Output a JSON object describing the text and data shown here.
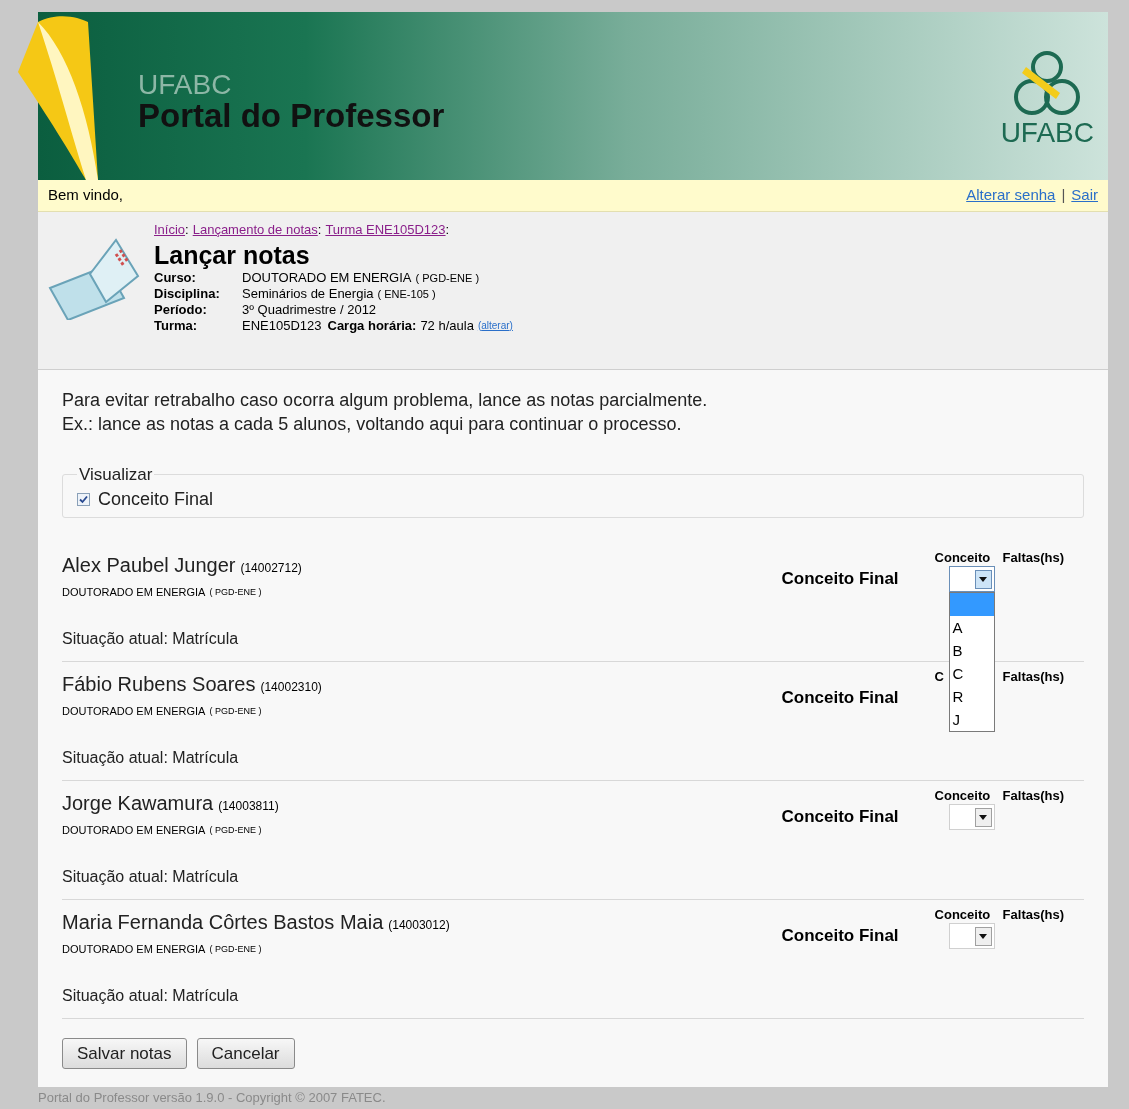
{
  "header": {
    "brand_small": "UFABC",
    "title": "Portal do Professor",
    "logo_text": "UFABC"
  },
  "welcome_bar": {
    "greeting": "Bem vindo,",
    "links": [
      "Alterar senha",
      "Sair"
    ],
    "separator": "|"
  },
  "breadcrumb": [
    "Início",
    "Lançamento de notas",
    "Turma ENE105D123"
  ],
  "breadcrumb_separator": ":",
  "page_title": "Lançar notas",
  "course_info": [
    {
      "label": "Curso:",
      "value": "DOUTORADO EM ENERGIA",
      "code": "( PGD-ENE )"
    },
    {
      "label": "Disciplina:",
      "value": "Seminários de Energia",
      "code": "( ENE-105 )"
    },
    {
      "label": "Período:",
      "value": "3º Quadrimestre / 2012"
    },
    {
      "label": "Turma:",
      "value": "ENE105D123",
      "extra_label": "Carga horária:",
      "extra_value": "72 h/aula",
      "link": "alterar",
      "link_open": "(",
      "link_close": ")"
    }
  ],
  "instructions": [
    "Para evitar retrabalho caso ocorra algum problema, lance as notas parcialmente.",
    "Ex.: lance as notas a cada 5 alunos, voltando aqui para continuar o processo."
  ],
  "view_options": {
    "legend": "Visualizar",
    "options": [
      {
        "label": "Conceito Final",
        "checked": true
      }
    ]
  },
  "students": [
    {
      "name": "Alex Paubel Junger",
      "id": "(14002712)",
      "course": "DOUTORADO EM ENERGIA",
      "code": "( PGD-ENE )",
      "status": "Situação atual: Matrícula",
      "grade_label": "Conceito Final",
      "col_headers": [
        "Conceito",
        "Faltas(hs)"
      ],
      "select_open": true,
      "options": [
        {
          "selected": true
        },
        {
          "label": "A",
          "selected": false
        },
        {
          "label": "B",
          "selected": false
        },
        {
          "label": "C",
          "selected": false
        },
        {
          "label": "R",
          "selected": false
        },
        {
          "label": "J",
          "selected": false
        }
      ]
    },
    {
      "name": "Fábio Rubens Soares",
      "id": "(14002310)",
      "course": "DOUTORADO EM ENERGIA",
      "code": "( PGD-ENE )",
      "status": "Situação atual: Matrícula",
      "grade_label": "Conceito Final",
      "col_headers": [
        "C",
        "Faltas(hs)"
      ]
    },
    {
      "name": "Jorge Kawamura",
      "id": "(14003811)",
      "course": "DOUTORADO EM ENERGIA",
      "code": "( PGD-ENE )",
      "status": "Situação atual: Matrícula",
      "grade_label": "Conceito Final",
      "col_headers": [
        "Conceito",
        "Faltas(hs)"
      ],
      "select_open": false
    },
    {
      "name": "Maria Fernanda Côrtes Bastos Maia",
      "id": "(14003012)",
      "course": "DOUTORADO EM ENERGIA",
      "code": "( PGD-ENE )",
      "status": "Situação atual: Matrícula",
      "grade_label": "Conceito Final",
      "col_headers": [
        "Conceito",
        "Faltas(hs)"
      ],
      "select_open": false
    }
  ],
  "buttons": [
    "Salvar notas",
    "Cancelar"
  ],
  "footer": "Portal do Professor versão 1.9.0 - Copyright © 2007 FATEC."
}
